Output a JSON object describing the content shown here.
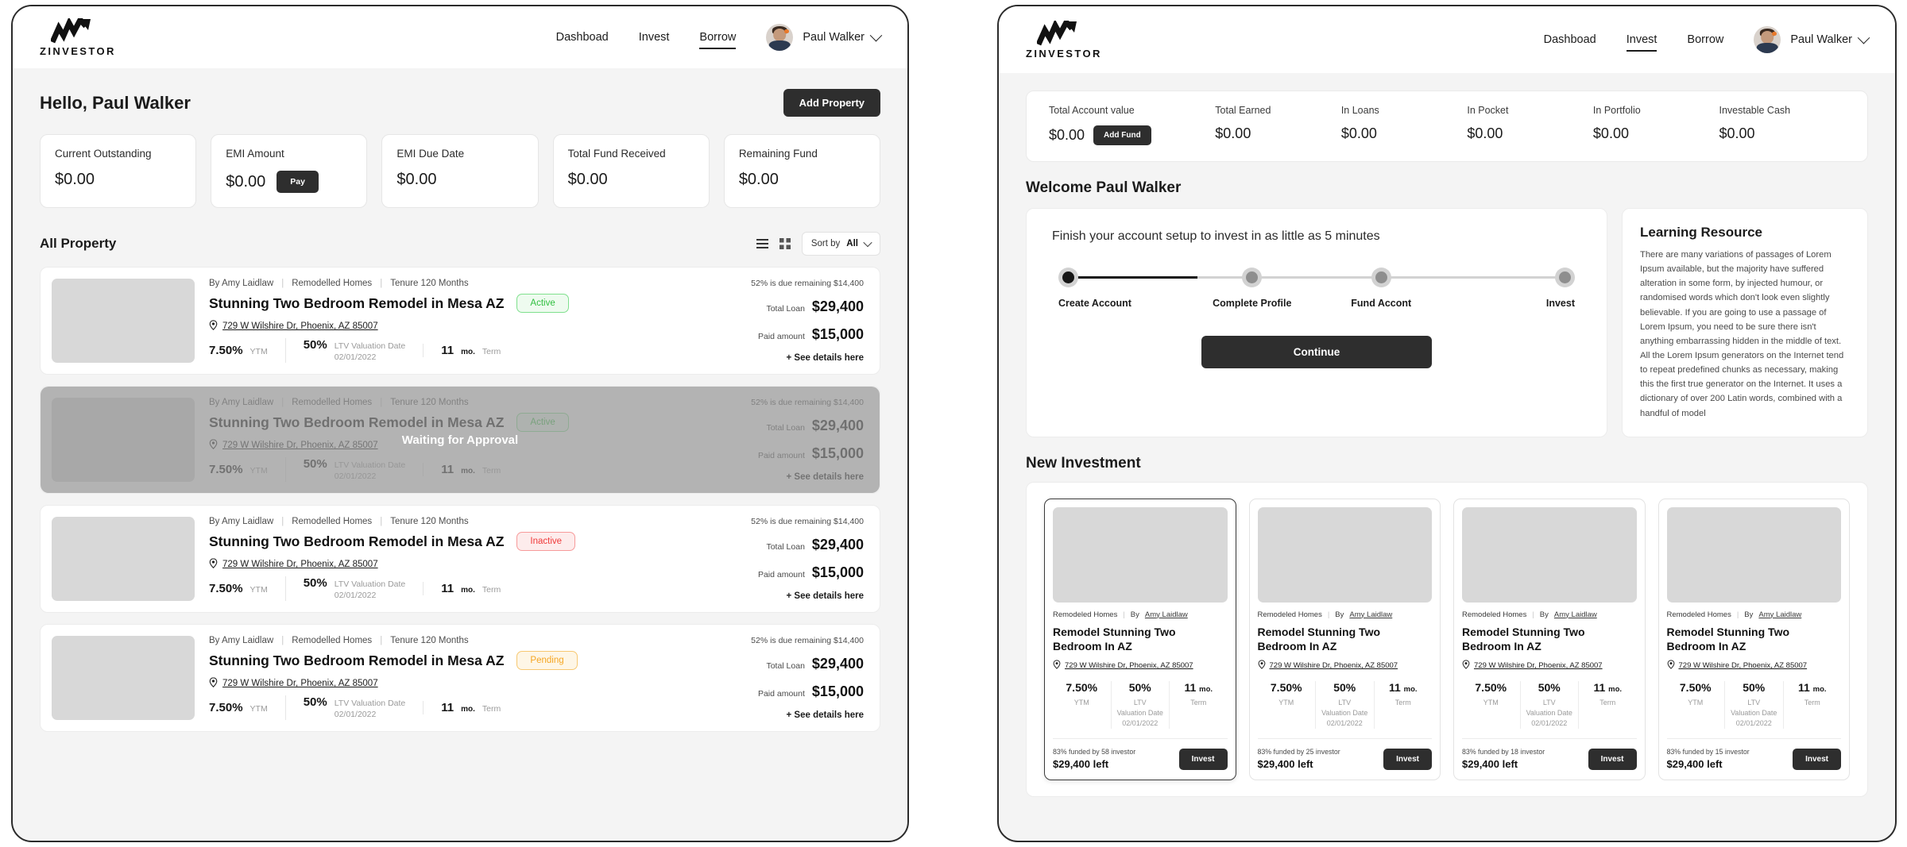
{
  "brand": {
    "name": "ZINVESTOR",
    "logo_icon": "growth-arrow-logo-icon"
  },
  "borrow_view": {
    "nav": {
      "items": [
        {
          "label": "Dashboad",
          "active": false
        },
        {
          "label": "Invest",
          "active": false
        },
        {
          "label": "Borrow",
          "active": true
        }
      ],
      "user_name": "Paul Walker",
      "avatar_icon": "user-avatar",
      "chevron_icon": "chevron-down-icon"
    },
    "greeting": "Hello, Paul Walker",
    "add_property_label": "Add Property",
    "stats": [
      {
        "label": "Current Outstanding",
        "value": "$0.00",
        "action": null
      },
      {
        "label": "EMI Amount",
        "value": "$0.00",
        "action": "Pay"
      },
      {
        "label": "EMI Due Date",
        "value": "$0.00",
        "action": null
      },
      {
        "label": "Total Fund Received",
        "value": "$0.00",
        "action": null
      },
      {
        "label": "Remaining Fund",
        "value": "$0.00",
        "action": null
      }
    ],
    "section": {
      "title": "All Property",
      "list_icon": "list-view-icon",
      "grid_icon": "grid-view-icon",
      "sort_prefix": "Sort by",
      "sort_value": "All",
      "sort_chevron_icon": "chevron-down-icon"
    },
    "properties": [
      {
        "author": "By Amy Laidlaw",
        "category": "Remodelled Homes",
        "tenure": "Tenure 120 Months",
        "title": "Stunning Two Bedroom Remodel in Mesa AZ",
        "status": "Active",
        "status_kind": "active",
        "address": "729 W Wilshire Dr, Phoenix, AZ 85007",
        "pin_icon": "map-pin-icon",
        "due_note": "52% is due remaining $14,400",
        "total_loan_label": "Total Loan",
        "total_loan_value": "$29,400",
        "paid_label": "Paid amount",
        "paid_value": "$15,000",
        "ytm_value": "7.50%",
        "ytm_label": "YTM",
        "ltv_value": "50%",
        "ltv_label": "LTV Valuation Date",
        "ltv_date": "02/01/2022",
        "term_value": "11",
        "term_unit": "mo.",
        "term_label": "Term",
        "details_link": "+ See details here",
        "overlay": null
      },
      {
        "author": "By Amy Laidlaw",
        "category": "Remodelled Homes",
        "tenure": "Tenure 120 Months",
        "title": "Stunning Two Bedroom Remodel in Mesa AZ",
        "status": "Active",
        "status_kind": "active",
        "address": "729 W Wilshire Dr, Phoenix, AZ 85007",
        "pin_icon": "map-pin-icon",
        "due_note": "52% is due remaining $14,400",
        "total_loan_label": "Total Loan",
        "total_loan_value": "$29,400",
        "paid_label": "Paid amount",
        "paid_value": "$15,000",
        "ytm_value": "7.50%",
        "ytm_label": "YTM",
        "ltv_value": "50%",
        "ltv_label": "LTV Valuation Date",
        "ltv_date": "02/01/2022",
        "term_value": "11",
        "term_unit": "mo.",
        "term_label": "Term",
        "details_link": "+ See details here",
        "overlay": "Waiting for Approval"
      },
      {
        "author": "By Amy Laidlaw",
        "category": "Remodelled Homes",
        "tenure": "Tenure 120 Months",
        "title": "Stunning Two Bedroom Remodel in Mesa AZ",
        "status": "Inactive",
        "status_kind": "inactive",
        "address": "729 W Wilshire Dr, Phoenix, AZ 85007",
        "pin_icon": "map-pin-icon",
        "due_note": "52% is due remaining $14,400",
        "total_loan_label": "Total Loan",
        "total_loan_value": "$29,400",
        "paid_label": "Paid amount",
        "paid_value": "$15,000",
        "ytm_value": "7.50%",
        "ytm_label": "YTM",
        "ltv_value": "50%",
        "ltv_label": "LTV Valuation Date",
        "ltv_date": "02/01/2022",
        "term_value": "11",
        "term_unit": "mo.",
        "term_label": "Term",
        "details_link": "+ See details here",
        "overlay": null
      },
      {
        "author": "By Amy Laidlaw",
        "category": "Remodelled Homes",
        "tenure": "Tenure 120 Months",
        "title": "Stunning Two Bedroom Remodel in Mesa AZ",
        "status": "Pending",
        "status_kind": "pending",
        "address": "729 W Wilshire Dr, Phoenix, AZ 85007",
        "pin_icon": "map-pin-icon",
        "due_note": "52% is due remaining $14,400",
        "total_loan_label": "Total Loan",
        "total_loan_value": "$29,400",
        "paid_label": "Paid amount",
        "paid_value": "$15,000",
        "ytm_value": "7.50%",
        "ytm_label": "YTM",
        "ltv_value": "50%",
        "ltv_label": "LTV Valuation Date",
        "ltv_date": "02/01/2022",
        "term_value": "11",
        "term_unit": "mo.",
        "term_label": "Term",
        "details_link": "+ See details here",
        "overlay": null
      }
    ]
  },
  "invest_view": {
    "nav": {
      "items": [
        {
          "label": "Dashboad",
          "active": false
        },
        {
          "label": "Invest",
          "active": true
        },
        {
          "label": "Borrow",
          "active": false
        }
      ],
      "user_name": "Paul Walker",
      "avatar_icon": "user-avatar",
      "chevron_icon": "chevron-down-icon"
    },
    "account_bar": {
      "add_fund_label": "Add Fund",
      "cells": [
        {
          "label": "Total Account value",
          "value": "$0.00"
        },
        {
          "label": "Total Earned",
          "value": "$0.00"
        },
        {
          "label": "In Loans",
          "value": "$0.00"
        },
        {
          "label": "In Pocket",
          "value": "$0.00"
        },
        {
          "label": "In Portfolio",
          "value": "$0.00"
        },
        {
          "label": "Investable Cash",
          "value": "$0.00"
        }
      ]
    },
    "welcome": "Welcome Paul Walker",
    "setup": {
      "headline": "Finish your account setup to invest in as little as 5 minutes",
      "steps": [
        {
          "label": "Create Account",
          "done": true
        },
        {
          "label": "Complete Profile",
          "done": false
        },
        {
          "label": "Fund Accont",
          "done": false
        },
        {
          "label": "Invest",
          "done": false
        }
      ],
      "continue_label": "Continue"
    },
    "learning": {
      "title": "Learning Resource",
      "body": "There are many variations of passages of Lorem Ipsum available, but the majority have suffered alteration in some form, by injected humour, or randomised words which don't look even slightly believable. If you are going to use a passage of Lorem Ipsum, you need to be sure there isn't anything embarrassing hidden in the middle of text. All the Lorem Ipsum generators on the Internet tend to repeat predefined chunks as necessary, making this the first true generator on the Internet. It uses a dictionary of over 200 Latin words, combined with a handful of model"
    },
    "new_investment_title": "New Investment",
    "investments": [
      {
        "category": "Remodeled Homes",
        "author_prefix": "By",
        "author": "Amy Laidlaw",
        "title": "Remodel Stunning Two Bedroom In  AZ",
        "address": "729 W Wilshire Dr, Phoenix, AZ 85007",
        "pin_icon": "map-pin-icon",
        "ytm_value": "7.50%",
        "ytm_label": "YTM",
        "ltv_value": "50%",
        "ltv_label": "LTV\nValuation Date\n02/01/2022",
        "term_value": "11",
        "term_unit": "mo.",
        "term_label": "Term",
        "funded": "83% funded by 58 investor",
        "left": "$29,400 left",
        "invest_label": "Invest",
        "selected": true
      },
      {
        "category": "Remodeled Homes",
        "author_prefix": "By",
        "author": "Amy Laidlaw",
        "title": "Remodel Stunning Two Bedroom In  AZ",
        "address": "729 W Wilshire Dr, Phoenix, AZ 85007",
        "pin_icon": "map-pin-icon",
        "ytm_value": "7.50%",
        "ytm_label": "YTM",
        "ltv_value": "50%",
        "ltv_label": "LTV\nValuation Date\n02/01/2022",
        "term_value": "11",
        "term_unit": "mo.",
        "term_label": "Term",
        "funded": "83% funded by 25 investor",
        "left": "$29,400 left",
        "invest_label": "Invest",
        "selected": false
      },
      {
        "category": "Remodeled Homes",
        "author_prefix": "By",
        "author": "Amy Laidlaw",
        "title": "Remodel Stunning Two Bedroom In  AZ",
        "address": "729 W Wilshire Dr, Phoenix, AZ 85007",
        "pin_icon": "map-pin-icon",
        "ytm_value": "7.50%",
        "ytm_label": "YTM",
        "ltv_value": "50%",
        "ltv_label": "LTV\nValuation Date\n02/01/2022",
        "term_value": "11",
        "term_unit": "mo.",
        "term_label": "Term",
        "funded": "83% funded by 18 investor",
        "left": "$29,400 left",
        "invest_label": "Invest",
        "selected": false
      },
      {
        "category": "Remodeled Homes",
        "author_prefix": "By",
        "author": "Amy Laidlaw",
        "title": "Remodel Stunning Two Bedroom In  AZ",
        "address": "729 W Wilshire Dr, Phoenix, AZ 85007",
        "pin_icon": "map-pin-icon",
        "ytm_value": "7.50%",
        "ytm_label": "YTM",
        "ltv_value": "50%",
        "ltv_label": "LTV\nValuation Date\n02/01/2022",
        "term_value": "11",
        "term_unit": "mo.",
        "term_label": "Term",
        "funded": "83% funded by 15 investor",
        "left": "$29,400 left",
        "invest_label": "Invest",
        "selected": false
      }
    ]
  },
  "colors": {
    "dark": "#2e2e2e",
    "page_bg": "#f4f4f4",
    "status_active": "#2fbf3f",
    "status_inactive": "#f03a3a",
    "status_pending": "#f5a623"
  }
}
